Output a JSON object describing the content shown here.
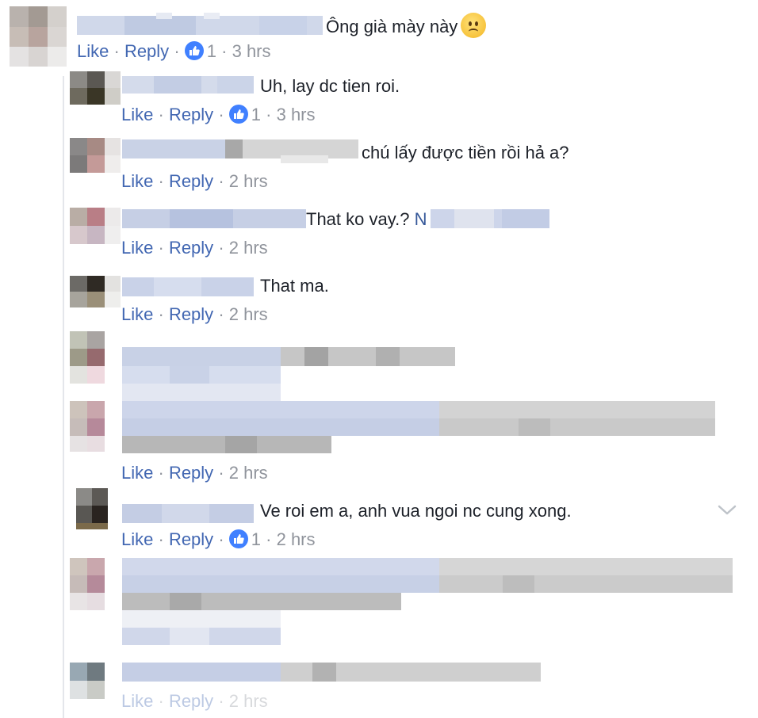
{
  "colors": {
    "link": "#4267b2",
    "meta": "#90949c",
    "text": "#1d2129",
    "like": "#4080ff"
  },
  "comments": [
    {
      "text": "Ông già mày này",
      "emoji": "worried-face",
      "like": "Like",
      "reply": "Reply",
      "count": "1",
      "time": "3 hrs"
    },
    {
      "text": "Uh, lay dc tien roi.",
      "like": "Like",
      "reply": "Reply",
      "count": "1",
      "time": "3 hrs"
    },
    {
      "text": "chú lấy được tiền rồi hả a?",
      "like": "Like",
      "reply": "Reply",
      "time": "2 hrs"
    },
    {
      "text": "That ko vay.?",
      "mention": "N",
      "like": "Like",
      "reply": "Reply",
      "time": "2 hrs"
    },
    {
      "text": "That ma.",
      "like": "Like",
      "reply": "Reply",
      "time": "2 hrs"
    },
    {
      "like": "Like",
      "reply": "Reply",
      "time": "2 hrs"
    },
    {
      "text": "Ve roi em a, anh vua ngoi nc cung xong.",
      "like": "Like",
      "reply": "Reply",
      "count": "1",
      "time": "2 hrs"
    },
    {
      "like": "Like",
      "reply": "Reply",
      "time": "2 hrs"
    }
  ],
  "icons": {
    "more": "chevron-down-icon",
    "like_badge": "thumbs-up-icon"
  }
}
